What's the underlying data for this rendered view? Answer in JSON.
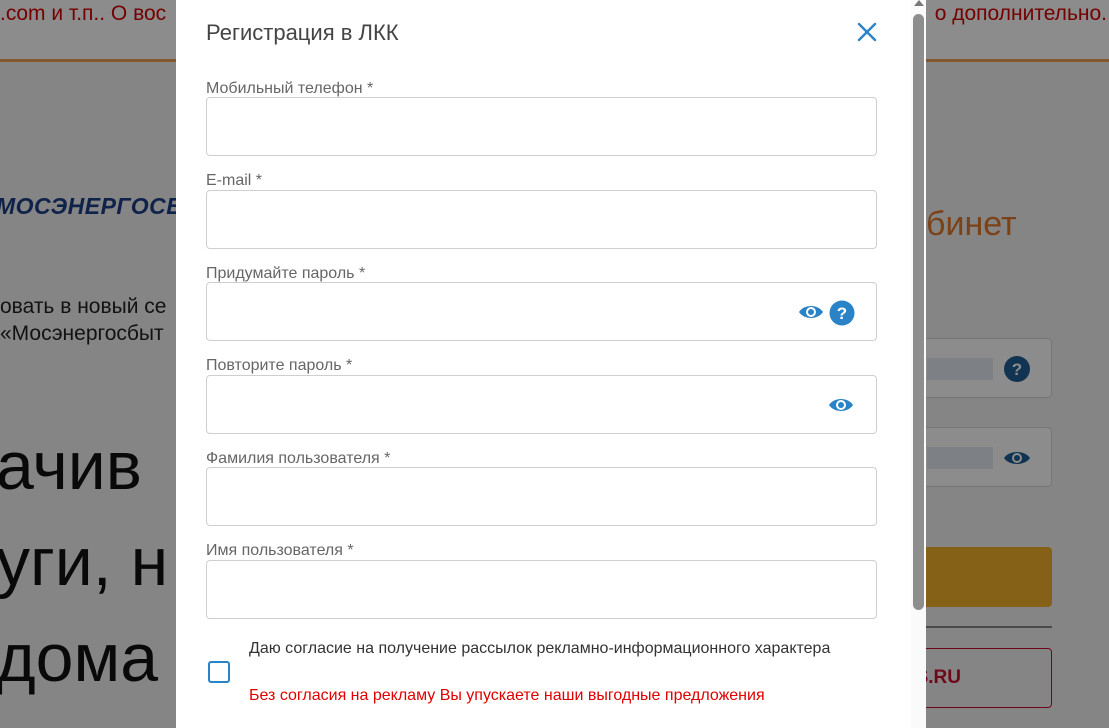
{
  "background": {
    "banner_left": ".com и т.п.. О вос",
    "banner_right": "о дополнительно.",
    "logo": "МОСЭНЕРГОСБЫТ",
    "intro_line1": "овать в новый се",
    "intro_line2": "«Мосэнергосбыт",
    "big_line1": "ачив",
    "big_line2": "уги, н",
    "big_line3": "дома",
    "cabinet_heading": "бинет",
    "link_text": "S.RU"
  },
  "modal": {
    "title": "Регистрация в ЛКК",
    "fields": [
      {
        "label": "Мобильный телефон *",
        "value": ""
      },
      {
        "label": "E-mail *",
        "value": ""
      },
      {
        "label": "Придумайте пароль *",
        "value": ""
      },
      {
        "label": "Повторите пароль *",
        "value": ""
      },
      {
        "label": "Фамилия пользователя *",
        "value": ""
      },
      {
        "label": "Имя пользователя *",
        "value": ""
      }
    ],
    "consent": {
      "text": "Даю согласие на получение рассылок рекламно-информационного характера",
      "warning": "Без согласия на рекламу Вы упускаете наши выгодные предложения",
      "checked": false
    }
  },
  "colors": {
    "accent": "#2a83c6",
    "warning": "#e00000",
    "title": "#444444"
  },
  "icons": [
    "close-icon",
    "eye-icon",
    "help-icon",
    "checkbox"
  ]
}
